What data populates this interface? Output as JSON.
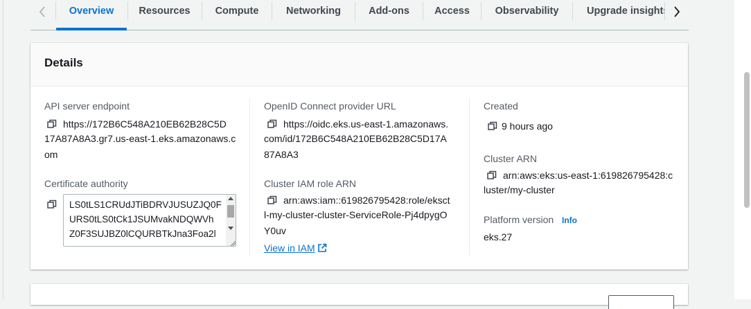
{
  "tabs": {
    "items": [
      {
        "label": "Overview",
        "active": true
      },
      {
        "label": "Resources"
      },
      {
        "label": "Compute"
      },
      {
        "label": "Networking"
      },
      {
        "label": "Add-ons"
      },
      {
        "label": "Access"
      },
      {
        "label": "Observability"
      },
      {
        "label": "Upgrade insights"
      }
    ],
    "prev_icon": "chevron-left-icon",
    "next_icon": "chevron-right-icon"
  },
  "details": {
    "title": "Details",
    "api_endpoint": {
      "label": "API server endpoint",
      "line1": "https://172B6C548A210EB62B28C5D",
      "line2": "17A87A8A3.gr7.us-east-1.eks.amazonaws.c",
      "line3": "om"
    },
    "certificate": {
      "label": "Certificate authority",
      "line1": "LS0tLS1CRUdJTiBDRVJUSUZJQ0F",
      "line2": "URS0tLS0tCk1JSUMvakNDQWVh",
      "line3": "Z0F3SUJBZ0lCQURBTkJna3Foa2l"
    },
    "oidc": {
      "label": "OpenID Connect provider URL",
      "line1": "https://oidc.eks.us-east-1.amazonaws.",
      "line2": "com/id/172B6C548A210EB62B28C5D17A",
      "line3": "87A8A3"
    },
    "iam_role": {
      "label": "Cluster IAM role ARN",
      "line1": "arn:aws:iam::619826795428:role/eksct",
      "line2": "l-my-cluster-cluster-ServiceRole-Pj4dpygO",
      "line3": "Y0uv",
      "link": "View in IAM"
    },
    "created": {
      "label": "Created",
      "value": "9 hours ago"
    },
    "cluster_arn": {
      "label": "Cluster ARN",
      "line1": "arn:aws:eks:us-east-1:619826795428:c",
      "line2": "luster/my-cluster"
    },
    "platform_version": {
      "label": "Platform version",
      "info": "Info",
      "value": "eks.27"
    }
  },
  "colors": {
    "accent": "#0972d3",
    "text": "#16191f",
    "label": "#545b64",
    "background": "#f2f3f3"
  }
}
